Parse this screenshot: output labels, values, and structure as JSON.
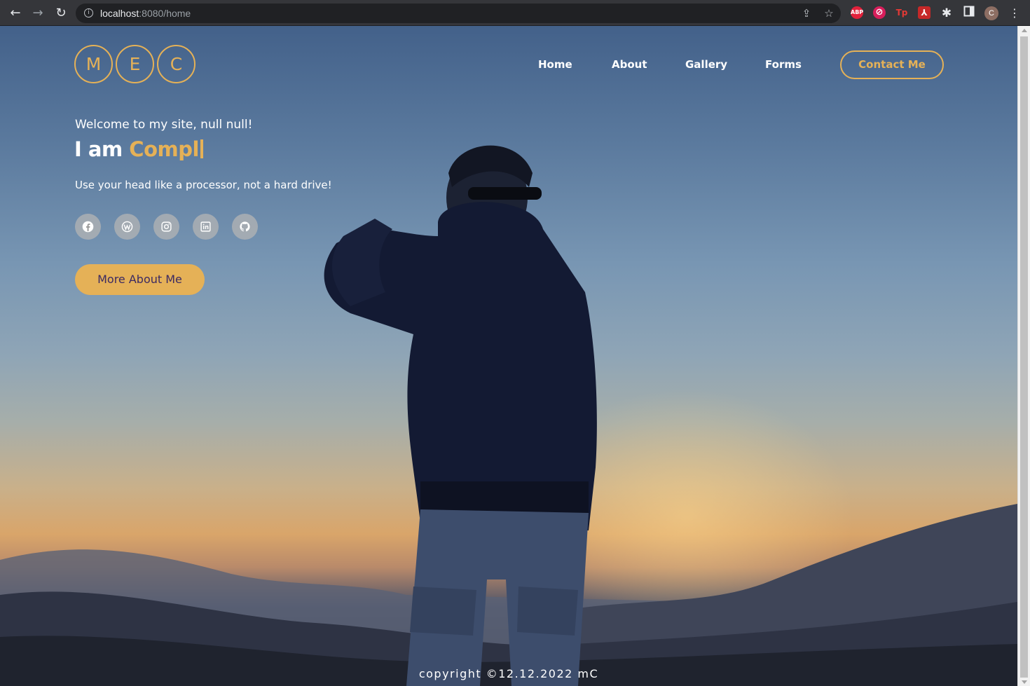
{
  "browser": {
    "url_host": "localhost",
    "url_rest": ":8080/home",
    "extensions": [
      {
        "name": "adblock-icon",
        "text": "ABP",
        "color": "#e3213b"
      },
      {
        "name": "privacy-icon",
        "text": "⊘",
        "color": "#d81e5b"
      },
      {
        "name": "tp-icon",
        "text": "Tp",
        "color": "#e53935"
      },
      {
        "name": "pdf-icon",
        "text": "⅄",
        "color": "#c62828"
      }
    ],
    "profile_initial": "C"
  },
  "site": {
    "logo_letters": [
      "M",
      "E",
      "C"
    ],
    "nav": {
      "home": "Home",
      "about": "About",
      "gallery": "Gallery",
      "forms": "Forms",
      "contact": "Contact Me"
    },
    "hero": {
      "welcome": "Welcome to my site, null null!",
      "headline_static": "I am ",
      "headline_typed": "Compl",
      "tagline": "Use your head like a processor, not a hard drive!",
      "button": "More About Me"
    },
    "social_icons": [
      "facebook-icon",
      "wordpress-icon",
      "instagram-icon",
      "linkedin-icon",
      "github-icon"
    ],
    "copyright": "copyright ©12.12.2022 mC"
  },
  "colors": {
    "accent": "#e5b157",
    "button_text": "#3c2a62",
    "chrome_bg": "#35363a"
  }
}
